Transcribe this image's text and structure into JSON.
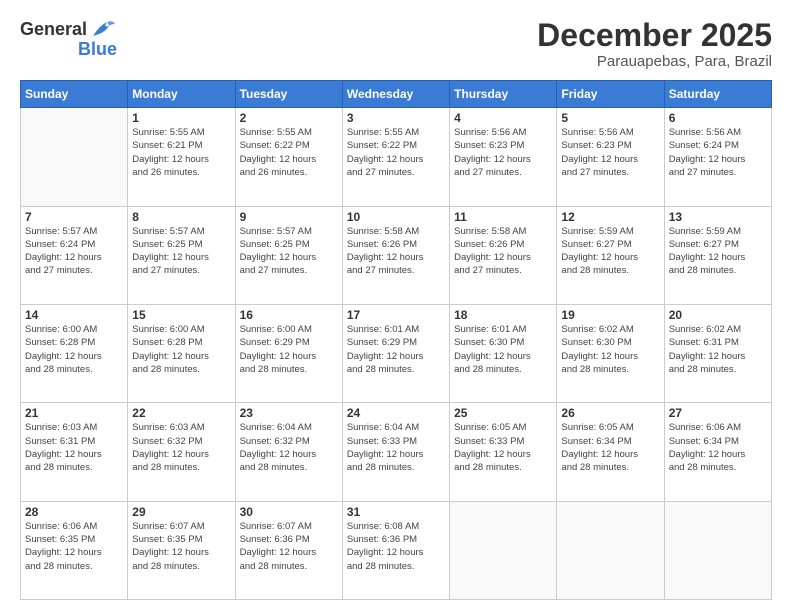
{
  "header": {
    "logo": {
      "general": "General",
      "blue": "Blue"
    },
    "title": "December 2025",
    "location": "Parauapebas, Para, Brazil"
  },
  "days_of_week": [
    "Sunday",
    "Monday",
    "Tuesday",
    "Wednesday",
    "Thursday",
    "Friday",
    "Saturday"
  ],
  "weeks": [
    [
      {
        "day": "",
        "info": ""
      },
      {
        "day": "1",
        "info": "Sunrise: 5:55 AM\nSunset: 6:21 PM\nDaylight: 12 hours\nand 26 minutes."
      },
      {
        "day": "2",
        "info": "Sunrise: 5:55 AM\nSunset: 6:22 PM\nDaylight: 12 hours\nand 26 minutes."
      },
      {
        "day": "3",
        "info": "Sunrise: 5:55 AM\nSunset: 6:22 PM\nDaylight: 12 hours\nand 27 minutes."
      },
      {
        "day": "4",
        "info": "Sunrise: 5:56 AM\nSunset: 6:23 PM\nDaylight: 12 hours\nand 27 minutes."
      },
      {
        "day": "5",
        "info": "Sunrise: 5:56 AM\nSunset: 6:23 PM\nDaylight: 12 hours\nand 27 minutes."
      },
      {
        "day": "6",
        "info": "Sunrise: 5:56 AM\nSunset: 6:24 PM\nDaylight: 12 hours\nand 27 minutes."
      }
    ],
    [
      {
        "day": "7",
        "info": "Sunrise: 5:57 AM\nSunset: 6:24 PM\nDaylight: 12 hours\nand 27 minutes."
      },
      {
        "day": "8",
        "info": "Sunrise: 5:57 AM\nSunset: 6:25 PM\nDaylight: 12 hours\nand 27 minutes."
      },
      {
        "day": "9",
        "info": "Sunrise: 5:57 AM\nSunset: 6:25 PM\nDaylight: 12 hours\nand 27 minutes."
      },
      {
        "day": "10",
        "info": "Sunrise: 5:58 AM\nSunset: 6:26 PM\nDaylight: 12 hours\nand 27 minutes."
      },
      {
        "day": "11",
        "info": "Sunrise: 5:58 AM\nSunset: 6:26 PM\nDaylight: 12 hours\nand 27 minutes."
      },
      {
        "day": "12",
        "info": "Sunrise: 5:59 AM\nSunset: 6:27 PM\nDaylight: 12 hours\nand 28 minutes."
      },
      {
        "day": "13",
        "info": "Sunrise: 5:59 AM\nSunset: 6:27 PM\nDaylight: 12 hours\nand 28 minutes."
      }
    ],
    [
      {
        "day": "14",
        "info": "Sunrise: 6:00 AM\nSunset: 6:28 PM\nDaylight: 12 hours\nand 28 minutes."
      },
      {
        "day": "15",
        "info": "Sunrise: 6:00 AM\nSunset: 6:28 PM\nDaylight: 12 hours\nand 28 minutes."
      },
      {
        "day": "16",
        "info": "Sunrise: 6:00 AM\nSunset: 6:29 PM\nDaylight: 12 hours\nand 28 minutes."
      },
      {
        "day": "17",
        "info": "Sunrise: 6:01 AM\nSunset: 6:29 PM\nDaylight: 12 hours\nand 28 minutes."
      },
      {
        "day": "18",
        "info": "Sunrise: 6:01 AM\nSunset: 6:30 PM\nDaylight: 12 hours\nand 28 minutes."
      },
      {
        "day": "19",
        "info": "Sunrise: 6:02 AM\nSunset: 6:30 PM\nDaylight: 12 hours\nand 28 minutes."
      },
      {
        "day": "20",
        "info": "Sunrise: 6:02 AM\nSunset: 6:31 PM\nDaylight: 12 hours\nand 28 minutes."
      }
    ],
    [
      {
        "day": "21",
        "info": "Sunrise: 6:03 AM\nSunset: 6:31 PM\nDaylight: 12 hours\nand 28 minutes."
      },
      {
        "day": "22",
        "info": "Sunrise: 6:03 AM\nSunset: 6:32 PM\nDaylight: 12 hours\nand 28 minutes."
      },
      {
        "day": "23",
        "info": "Sunrise: 6:04 AM\nSunset: 6:32 PM\nDaylight: 12 hours\nand 28 minutes."
      },
      {
        "day": "24",
        "info": "Sunrise: 6:04 AM\nSunset: 6:33 PM\nDaylight: 12 hours\nand 28 minutes."
      },
      {
        "day": "25",
        "info": "Sunrise: 6:05 AM\nSunset: 6:33 PM\nDaylight: 12 hours\nand 28 minutes."
      },
      {
        "day": "26",
        "info": "Sunrise: 6:05 AM\nSunset: 6:34 PM\nDaylight: 12 hours\nand 28 minutes."
      },
      {
        "day": "27",
        "info": "Sunrise: 6:06 AM\nSunset: 6:34 PM\nDaylight: 12 hours\nand 28 minutes."
      }
    ],
    [
      {
        "day": "28",
        "info": "Sunrise: 6:06 AM\nSunset: 6:35 PM\nDaylight: 12 hours\nand 28 minutes."
      },
      {
        "day": "29",
        "info": "Sunrise: 6:07 AM\nSunset: 6:35 PM\nDaylight: 12 hours\nand 28 minutes."
      },
      {
        "day": "30",
        "info": "Sunrise: 6:07 AM\nSunset: 6:36 PM\nDaylight: 12 hours\nand 28 minutes."
      },
      {
        "day": "31",
        "info": "Sunrise: 6:08 AM\nSunset: 6:36 PM\nDaylight: 12 hours\nand 28 minutes."
      },
      {
        "day": "",
        "info": ""
      },
      {
        "day": "",
        "info": ""
      },
      {
        "day": "",
        "info": ""
      }
    ]
  ]
}
